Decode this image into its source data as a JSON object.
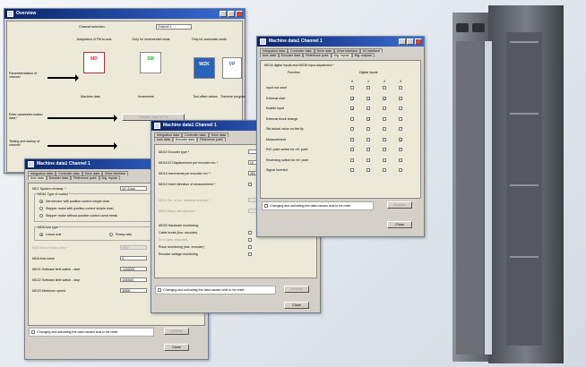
{
  "overview": {
    "title": "Overview",
    "channel_selection_label": "Channel selection",
    "channel_value": "Channel 1",
    "col_adaptation": "Adaptation of FM to axis",
    "col_incremental": "Only for incremental mode",
    "col_automatic": "Only for automatic mode",
    "row_parameterization": "Parameterization of channel",
    "row_enter": "Enter parameter-ization data?",
    "row_testing": "Testing and startup of channel",
    "tile_md": "MD",
    "tile_sm": "SM",
    "tile_wzk": "WZK",
    "tile_vp": "VP",
    "label_machine_data": "Machine data",
    "label_increments": "Increments",
    "label_tool_offset": "Tool offset values",
    "label_traverse": "Traverse program",
    "transfer_button": "Transfer data to FM"
  },
  "win_axis": {
    "title": "Machine data1  Channel 1",
    "tabs_row1": [
      "Integration data",
      "Controller data",
      "Drive data",
      "Drive interface"
    ],
    "tabs_row2": [
      "Axis data",
      "Encoder data",
      "Reference point",
      "Dig. inputs"
    ],
    "md7_label": "MD7 System of meas. *",
    "md7_value": "10^-3 mm",
    "md61_label": "MD61 Type of control *",
    "opt1": "Servomotor with position control simple chan.",
    "opt2": "Stepper motor with position control simple chan.",
    "opt3": "Stepper motor without position control curve break",
    "md8_label": "MD8 Axis type *",
    "linear": "Linear axis",
    "rotary": "Rotary axis",
    "md9_label": "MD9 End of rotary axis *",
    "md9_value": "3600",
    "md6_label": "MD6 Axis name",
    "md6_value": "X",
    "md21_label": "MD21 Software limit switch - start",
    "md21_value": "-1000000",
    "md22_label": "MD22 Software limit switch - stop",
    "md22_value": "1000000",
    "md23_label": "MD23 Maximum speed",
    "md23_value": "30000",
    "note": "Changing and activating the data causes axis to be reset.",
    "activate": "Activate",
    "close": "Close"
  },
  "win_encoder": {
    "title": "Machine data1  Channel 1",
    "tabs_row1": [
      "Integration data",
      "Controller data",
      "Drive data"
    ],
    "tabs_row2": [
      "Axis data",
      "Encoder data",
      "Reference point"
    ],
    "md10_label": "MD10 Encoder type *",
    "md11_label": "MD11/12 Displacement per encoder rev. *",
    "md11_value": "10",
    "md13_label": "MD13 Increments per encoder rev. *",
    "md13_value": "250",
    "md19_label": "MD19 Invert direction of measurement *",
    "md14_label": "MD14 No. of rev. absolute encoder *",
    "md15_label": "MD15 Baud rate absolute *",
    "md20_label": "MD20 Hardware monitoring:",
    "mon1": "Cable break (incr. encoder)",
    "mon2": "Error (abs. encoder)",
    "mon3": "Pulse monitoring (incr. encoder)",
    "mon4": "Encoder voltage monitoring",
    "note": "Changing and activating the data causes axis to be reset.",
    "activate": "Activate",
    "close": "Close"
  },
  "win_digital": {
    "title": "Machine data1  Channel 1",
    "tabs_row1": [
      "Integration data",
      "Controller data",
      "Drive data",
      "Drive interface",
      "I/2 interface"
    ],
    "tabs_row2": [
      "Axis data",
      "Encoder data",
      "Reference point",
      "Dig. Inputs",
      "Dig. outputs"
    ],
    "heading": "MD34 digital inputs and MD36 input adjustment *",
    "col_function": "Function",
    "col_inputs": "Digital inputs",
    "input_numbers": [
      "0",
      "1",
      "2",
      "3"
    ],
    "functions": [
      "Input not used",
      "External start",
      "Enable input",
      "External block change",
      "Set actual value on-the-fly",
      "Measurement",
      "Ref. point switch for ref. point",
      "Reversing switch for ref. point",
      "Signal inverted"
    ],
    "note": "Changing and activating the data causes axis to be reset.",
    "activate": "Activate",
    "close": "Close"
  }
}
